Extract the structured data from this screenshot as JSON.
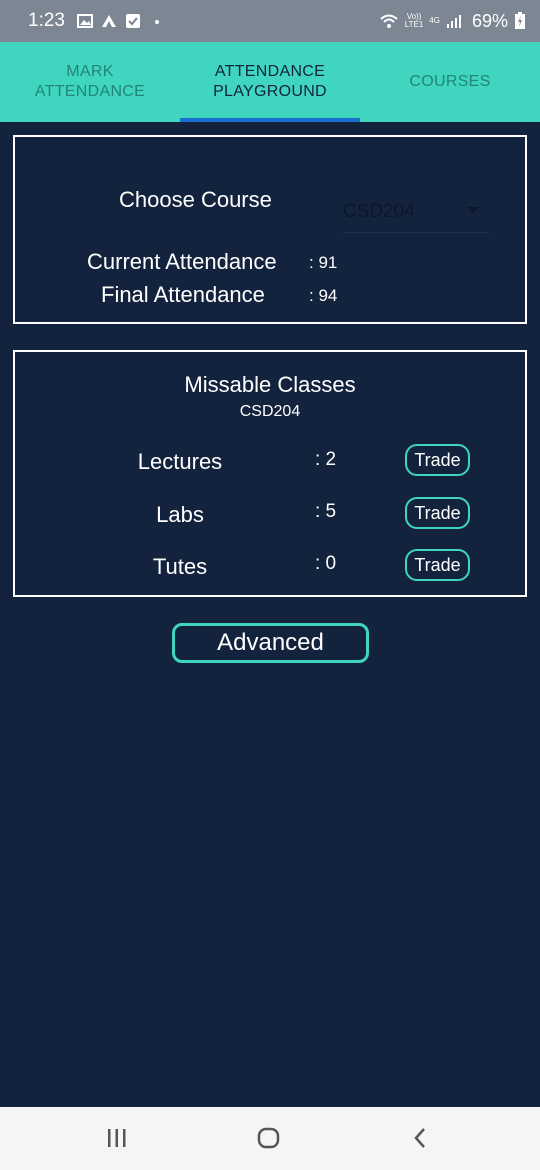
{
  "status_bar": {
    "time": "1:23",
    "left_icons": [
      "image-icon",
      "app-icon",
      "checkbox-icon",
      "dot-icon"
    ],
    "network_top": "Vo))",
    "network_bottom": "LTE1",
    "network_type": "4G",
    "battery": "69%"
  },
  "tabs": [
    {
      "label": "MARK\nATTENDANCE",
      "active": false
    },
    {
      "label": "ATTENDANCE\nPLAYGROUND",
      "active": true
    },
    {
      "label": "COURSES",
      "active": false
    }
  ],
  "course_panel": {
    "choose_label": "Choose Course",
    "selected_course": "CSD204",
    "current_label": "Current Attendance",
    "current_value": ": 91",
    "final_label": "Final Attendance",
    "final_value": ": 94"
  },
  "missable": {
    "title": "Missable Classes",
    "course": "CSD204",
    "rows": [
      {
        "label": "Lectures",
        "value": ": 2",
        "button": "Trade"
      },
      {
        "label": "Labs",
        "value": ": 5",
        "button": "Trade"
      },
      {
        "label": "Tutes",
        "value": ": 0",
        "button": "Trade"
      }
    ]
  },
  "advanced_label": "Advanced",
  "nav": [
    "recent-apps-icon",
    "home-icon",
    "back-icon"
  ],
  "colors": {
    "background": "#13233d",
    "accent": "#3fd5bf",
    "tab_text": "#238577",
    "indicator": "#1a6fd1"
  }
}
